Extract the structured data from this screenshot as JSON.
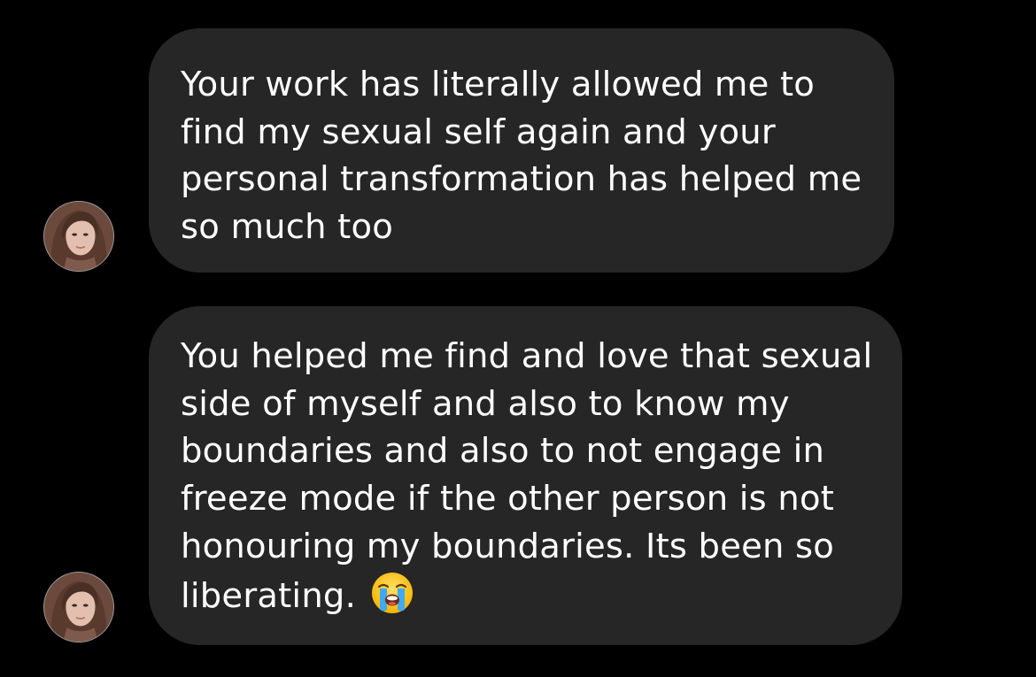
{
  "messages": [
    {
      "lines": [
        "Your work has literally allowed me to",
        "find my sexual self again and your",
        "personal transformation has helped me",
        "so much too"
      ],
      "emoji": ""
    },
    {
      "lines": [
        "You helped me find and love that sexual",
        "side of myself and also to know my",
        "boundaries and also to not engage in",
        "freeze mode if the other person is not",
        "honouring my boundaries. Its been so",
        "liberating."
      ],
      "emoji": "loudly-crying-face"
    }
  ],
  "colors": {
    "background": "#000000",
    "bubble": "#262626",
    "text": "#ffffff"
  },
  "icons": {
    "avatar": "user-avatar-photo",
    "emoji": "loudly-crying-face-emoji"
  }
}
